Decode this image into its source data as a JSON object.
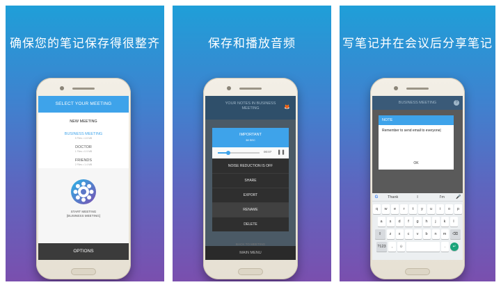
{
  "captions": [
    "确保您的笔记保存得很整齐",
    "保存和播放音频",
    "写笔记并在会议后分享笔记"
  ],
  "screen1": {
    "header": "SELECT YOUR MEETING",
    "new_meeting": "NEW MEETING",
    "meetings": [
      {
        "name": "BUSINESS MEETING",
        "sub": "5 Files • 4.8 MB",
        "selected": true
      },
      {
        "name": "DOCTOR",
        "sub": "1 Files • 0.9 MB",
        "selected": false
      },
      {
        "name": "FRIENDS",
        "sub": "2 Files • 1.4 MB",
        "selected": false
      }
    ],
    "start_line1": "START MEETING",
    "start_line2": "[BUSINESS MEETING]",
    "options": "OPTIONS",
    "icon": "gear-icon"
  },
  "screen2": {
    "header_line1": "YOUR NOTES IN BUSINESS",
    "header_line2": "MEETING",
    "header_icon": "fox-icon",
    "note_title": "IMPORTANT",
    "note_duration": "38 SEC",
    "time": "00:07",
    "progress": 0.25,
    "noise": "NOISE REDUCTION IS OFF",
    "share": "SHARE",
    "export": "EXPORT",
    "rename": "RENAME",
    "delete": "DELETE",
    "back": "BACK TO MEETING",
    "main_menu": "MAIN MENU",
    "accent": "#3ea3ea"
  },
  "screen3": {
    "header": "BUSINESS MEETING",
    "dialog_title": "NOTE",
    "note_text": "Remember to send email to everyone|",
    "ok": "OK",
    "suggestions": [
      "Thank",
      "I",
      "I'm"
    ],
    "rows": [
      [
        "q",
        "w",
        "e",
        "r",
        "t",
        "y",
        "u",
        "i",
        "o",
        "p"
      ],
      [
        "a",
        "s",
        "d",
        "f",
        "g",
        "h",
        "j",
        "k",
        "l"
      ],
      [
        "⇧",
        "z",
        "x",
        "c",
        "v",
        "b",
        "n",
        "m",
        "⌫"
      ],
      [
        "?123",
        ",",
        "☺",
        "",
        ".",
        "↵"
      ]
    ]
  }
}
